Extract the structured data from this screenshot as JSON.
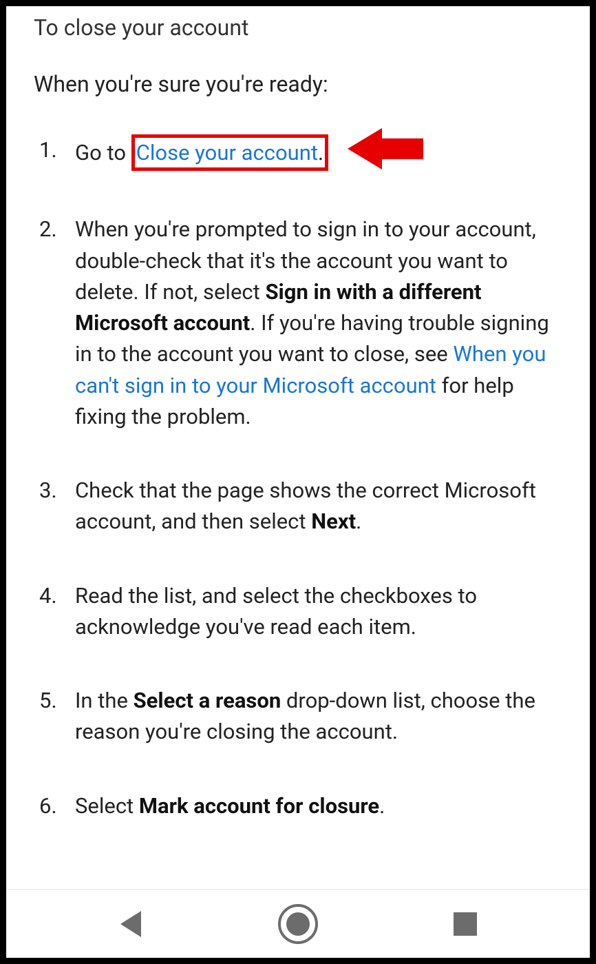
{
  "heading": "To close your account",
  "subheading": "When you're sure you're ready:",
  "steps": {
    "s1": {
      "prefix": "Go to",
      "link": "Close your account",
      "suffix": "."
    },
    "s2": {
      "a": "When you're prompted to sign in to your account, double-check that it's the account you want to delete. If not, select ",
      "bold1": "Sign in with a different Microsoft account",
      "b": ". If you're having trouble signing in to the account you want to close, see ",
      "link": "When you can't sign in to your Microsoft account",
      "c": " for help fixing the problem."
    },
    "s3": {
      "a": "Check that the page shows the correct Microsoft account, and then select ",
      "bold": "Next",
      "b": "."
    },
    "s4": "Read the list, and select the checkboxes to acknowledge you've read each item.",
    "s5": {
      "a": "In the ",
      "bold": "Select a reason",
      "b": " drop-down list, choose the reason you're closing the account."
    },
    "s6": {
      "a": "Select ",
      "bold": "Mark account for closure",
      "b": "."
    }
  },
  "colors": {
    "link": "#1976d2",
    "highlight": "#e60000",
    "nav": "#6c6c6c"
  }
}
